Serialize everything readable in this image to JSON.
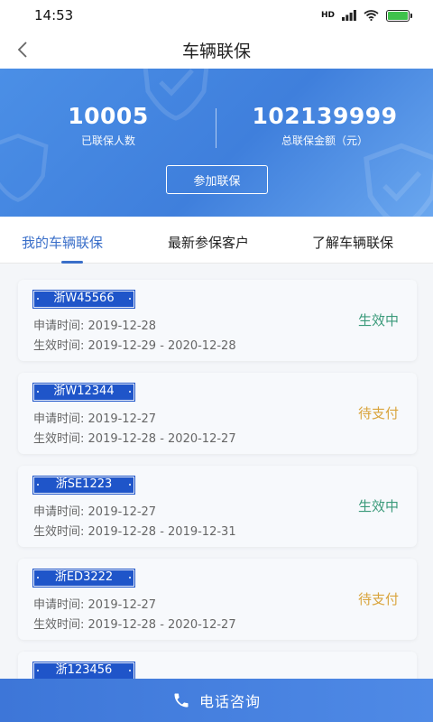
{
  "status_bar": {
    "time": "14:53",
    "network_label": "HD"
  },
  "nav": {
    "title": "车辆联保"
  },
  "banner": {
    "insured_count": "10005",
    "insured_count_label": "已联保人数",
    "total_amount": "102139999",
    "total_amount_label": "总联保金额（元）",
    "join_button": "参加联保"
  },
  "tabs": [
    {
      "label": "我的车辆联保",
      "active": true
    },
    {
      "label": "最新参保客户",
      "active": false
    },
    {
      "label": "了解车辆联保",
      "active": false
    }
  ],
  "records": [
    {
      "plate": "浙W45566",
      "apply_label": "申请时间:",
      "apply_date": "2019-12-28",
      "effective_label": "生效时间:",
      "effective_range": "2019-12-29 - 2020-12-28",
      "status": "生效中",
      "status_type": "active"
    },
    {
      "plate": "浙W12344",
      "apply_label": "申请时间:",
      "apply_date": "2019-12-27",
      "effective_label": "生效时间:",
      "effective_range": "2019-12-28 - 2020-12-27",
      "status": "待支付",
      "status_type": "pending"
    },
    {
      "plate": "浙SE1223",
      "apply_label": "申请时间:",
      "apply_date": "2019-12-27",
      "effective_label": "生效时间:",
      "effective_range": "2019-12-28 - 2019-12-31",
      "status": "生效中",
      "status_type": "active"
    },
    {
      "plate": "浙ED3222",
      "apply_label": "申请时间:",
      "apply_date": "2019-12-27",
      "effective_label": "生效时间:",
      "effective_range": "2019-12-28 - 2020-12-27",
      "status": "待支付",
      "status_type": "pending"
    },
    {
      "plate": "浙123456",
      "apply_label": "",
      "apply_date": "",
      "effective_label": "",
      "effective_range": "",
      "status": "",
      "status_type": ""
    }
  ],
  "bottom": {
    "phone_label": "电话咨询"
  },
  "colors": {
    "primary": "#3a6fc9",
    "active": "#3a9a7a",
    "pending": "#d9a43c",
    "plate": "#1f55c9"
  }
}
